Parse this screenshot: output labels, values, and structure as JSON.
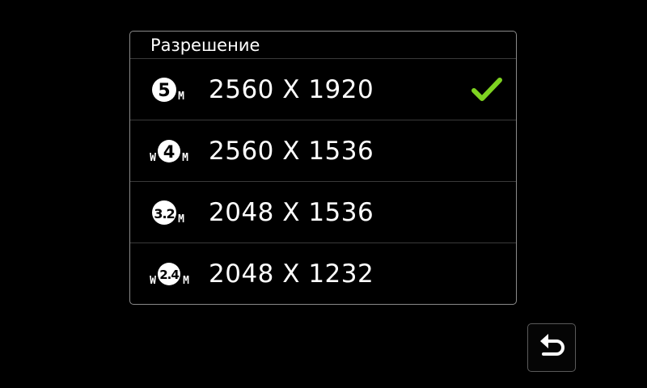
{
  "dialog": {
    "title": "Разрешение",
    "options": [
      {
        "icon": "5m-resolution-icon",
        "label": "2560 X 1920",
        "selected": true
      },
      {
        "icon": "w4m-resolution-icon",
        "label": "2560 X 1536",
        "selected": false
      },
      {
        "icon": "3.2m-resolution-icon",
        "label": "2048 X 1536",
        "selected": false
      },
      {
        "icon": "w2.4m-resolution-icon",
        "label": "2048 X 1232",
        "selected": false
      }
    ]
  },
  "icon_text": {
    "icon1_main": "5",
    "icon1_suffix": "M",
    "icon2_prefix": "W",
    "icon2_main": "4",
    "icon2_suffix": "M",
    "icon3_main": "3.2",
    "icon3_suffix": "M",
    "icon4_prefix": "W",
    "icon4_main": "2.4",
    "icon4_suffix": "M"
  },
  "colors": {
    "background": "#000000",
    "text": "#ffffff",
    "check": "#7ed321",
    "border": "#8a8a8a"
  },
  "back_button": {
    "icon": "back-arrow-icon"
  }
}
